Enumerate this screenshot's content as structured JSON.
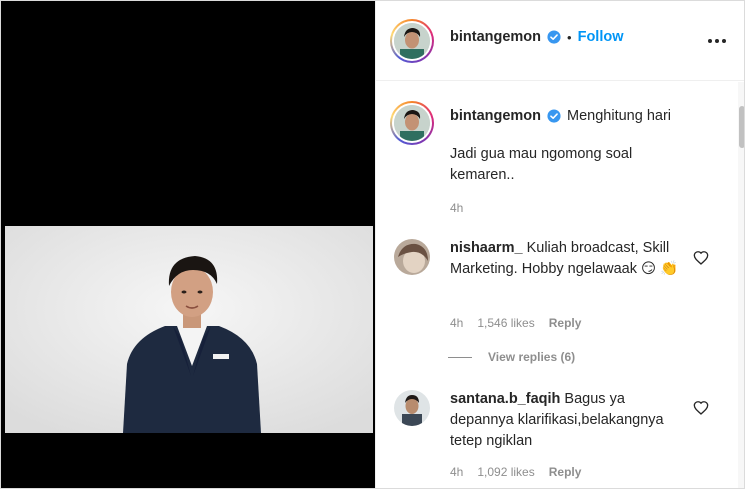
{
  "header": {
    "username": "bintangemon",
    "separator": "•",
    "follow_label": "Follow",
    "more_icon": "more-horizontal-icon"
  },
  "caption": {
    "username": "bintangemon",
    "text": "Menghitung hari",
    "body": "Jadi gua mau ngomong soal kemaren..",
    "time": "4h"
  },
  "comments": [
    {
      "username": "nishaarm_",
      "text": "Kuliah broadcast, Skill Marketing. Hobby ngelawaak 😏 👏",
      "time": "4h",
      "likes": "1,546 likes",
      "reply_label": "Reply",
      "view_replies": "View replies (6)"
    },
    {
      "username": "santana.b_faqih",
      "text": "Bagus ya depannya klarifikasi,belakangnya tetep ngiklan",
      "time": "4h",
      "likes": "1,092 likes",
      "reply_label": "Reply"
    }
  ],
  "colors": {
    "accent": "#0095f6",
    "verified": "#3897f0",
    "meta": "#8e8e8e",
    "text": "#262626"
  }
}
